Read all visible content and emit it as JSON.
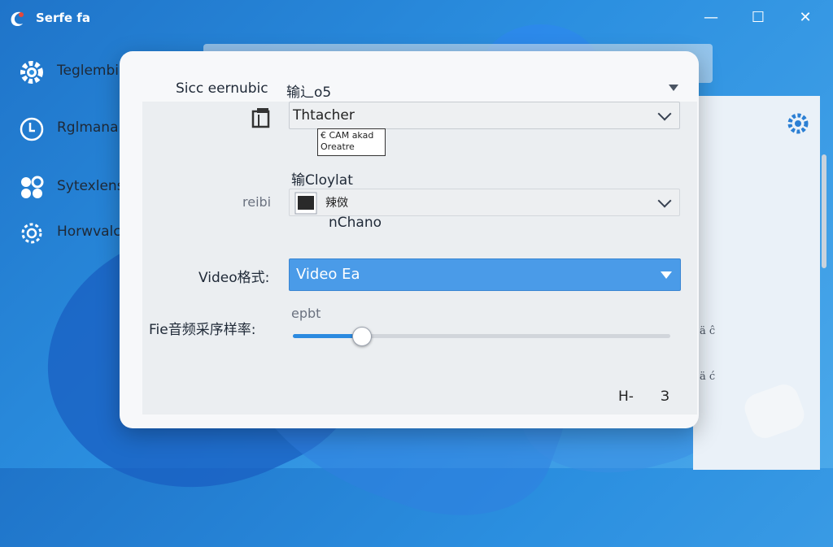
{
  "window": {
    "title": "Serfe fa",
    "controls": {
      "minimize": "—",
      "maximize": "☐",
      "close": "✕"
    }
  },
  "sidebar": {
    "items": [
      {
        "label": "Teglembi",
        "icon": "gear-icon"
      },
      {
        "label": "Rglmana",
        "icon": "clock-icon"
      },
      {
        "label": "Sytexlens",
        "icon": "apps-icon"
      },
      {
        "label": "Horwvalc",
        "icon": "settings-icon"
      }
    ]
  },
  "dialog": {
    "source_label": "Sicc eernubic",
    "output_label": "输辶o5",
    "camera_dropdown": {
      "value": "Thtacher"
    },
    "camera_popup": {
      "line1": "€ CAM akad",
      "line2": "Oreatre"
    },
    "section_label": "输Cloylat",
    "row_label": "reibi",
    "device_dropdown": {
      "value": "辣傚"
    },
    "device_name": "nChano",
    "video_format_label": "Video格式:",
    "video_format_dropdown": {
      "value": "Video Ea"
    },
    "sample_rate_label": "Fie音频采序样率:",
    "sample_rate_value_label": "epbt",
    "sample_rate_slider": {
      "value_fraction": 0.18
    },
    "footer": {
      "left_button": "H-",
      "right_button": "З"
    }
  },
  "background": {
    "marks": [
      "ä ĉ",
      "ä ć"
    ]
  },
  "colors": {
    "accent": "#4a9be8",
    "slider_fill": "#2b8ae0",
    "desktop": "#2b8fe0"
  }
}
